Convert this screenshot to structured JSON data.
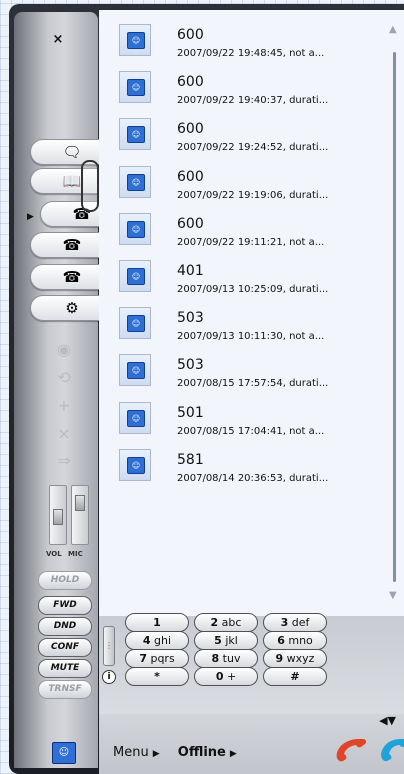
{
  "window": {
    "close_label": "×"
  },
  "side_tabs": [
    {
      "icon": "speech-bubble-icon",
      "glyph": "🗨"
    },
    {
      "icon": "address-book-icon",
      "glyph": "📖"
    },
    {
      "icon": "phone-pickup-icon",
      "glyph": "☎"
    },
    {
      "icon": "phone-incoming-icon",
      "glyph": "☎"
    },
    {
      "icon": "phone-outgoing-icon",
      "glyph": "☎"
    },
    {
      "icon": "conference-icon",
      "glyph": "⚙"
    }
  ],
  "disabled_actions": [
    {
      "icon": "eye-icon",
      "glyph": "◉"
    },
    {
      "icon": "refresh-icon",
      "glyph": "⟲"
    },
    {
      "icon": "plus-icon",
      "glyph": "+"
    },
    {
      "icon": "cross-icon",
      "glyph": "×"
    },
    {
      "icon": "forward-icon",
      "glyph": "⇒"
    }
  ],
  "audio": {
    "vol_label": "VOL",
    "mic_label": "MIC",
    "vol_level": 0.45,
    "mic_level": 0.78
  },
  "function_buttons": [
    {
      "label": "HOLD",
      "enabled": false
    },
    {
      "label": "FWD",
      "enabled": true
    },
    {
      "label": "DND",
      "enabled": true
    },
    {
      "label": "CONF",
      "enabled": true
    },
    {
      "label": "MUTE",
      "enabled": true
    },
    {
      "label": "TRNSF",
      "enabled": false
    }
  ],
  "calls": [
    {
      "number": "600",
      "detail": "2007/09/22 19:48:45, not a..."
    },
    {
      "number": "600",
      "detail": "2007/09/22 19:40:37, durati..."
    },
    {
      "number": "600",
      "detail": "2007/09/22 19:24:52, durati..."
    },
    {
      "number": "600",
      "detail": "2007/09/22 19:19:06, durati..."
    },
    {
      "number": "600",
      "detail": "2007/09/22 19:11:21, not a..."
    },
    {
      "number": "401",
      "detail": "2007/09/13 10:25:09, durati..."
    },
    {
      "number": "503",
      "detail": "2007/09/13 10:11:30, not a..."
    },
    {
      "number": "503",
      "detail": "2007/08/15 17:57:54, durati..."
    },
    {
      "number": "501",
      "detail": "2007/08/15 17:04:41, not a..."
    },
    {
      "number": "581",
      "detail": "2007/08/14 20:36:53, durati..."
    }
  ],
  "dialpad": [
    {
      "digit": "1",
      "letters": ""
    },
    {
      "digit": "2",
      "letters": "abc"
    },
    {
      "digit": "3",
      "letters": "def"
    },
    {
      "digit": "4",
      "letters": "ghi"
    },
    {
      "digit": "5",
      "letters": "jkl"
    },
    {
      "digit": "6",
      "letters": "mno"
    },
    {
      "digit": "7",
      "letters": "pqrs"
    },
    {
      "digit": "8",
      "letters": "tuv"
    },
    {
      "digit": "9",
      "letters": "wxyz"
    },
    {
      "digit": "*",
      "letters": ""
    },
    {
      "digit": "0",
      "letters": "+"
    },
    {
      "digit": "#",
      "letters": ""
    }
  ],
  "status_bar": {
    "menu_label": "Menu",
    "status_label": "Offline"
  },
  "colors": {
    "hangup": "#e0452a",
    "answer": "#1fa3d9",
    "list_bg": "#f2f6fc"
  }
}
